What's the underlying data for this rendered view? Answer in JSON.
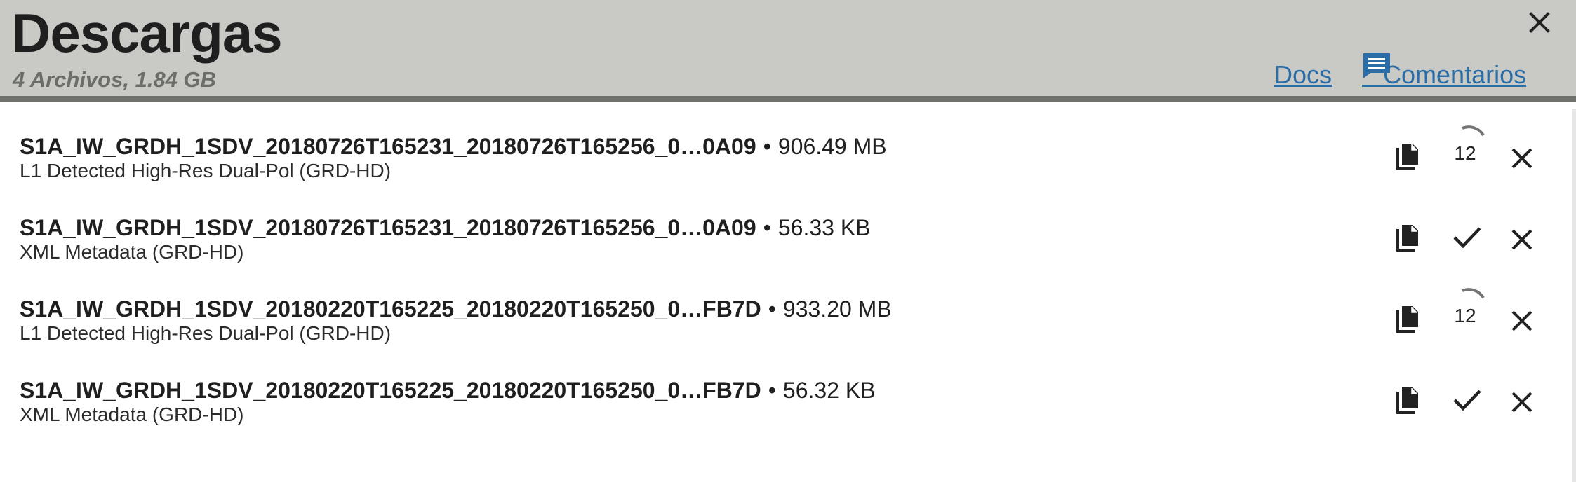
{
  "header": {
    "title": "Descargas",
    "subtitle": "4 Archivos, 1.84 GB",
    "docs_label": "Docs",
    "feedback_label": "Comentarios",
    "close_icon": "close-icon",
    "feedback_icon": "comment-icon"
  },
  "colors": {
    "header_bg": "#c9cac6",
    "header_border": "#6f716d",
    "link": "#2a6da7",
    "text": "#1f1f1f"
  },
  "downloads": [
    {
      "name": "S1A_IW_GRDH_1SDV_20180726T165231_20180726T165256_0…0A09",
      "size": "906.49 MB",
      "type": "L1 Detected High-Res Dual-Pol (GRD-HD)",
      "status": "downloading",
      "progress_text": "12"
    },
    {
      "name": "S1A_IW_GRDH_1SDV_20180726T165231_20180726T165256_0…0A09",
      "size": "56.33 KB",
      "type": "XML Metadata (GRD-HD)",
      "status": "complete",
      "progress_text": ""
    },
    {
      "name": "S1A_IW_GRDH_1SDV_20180220T165225_20180220T165250_0…FB7D",
      "size": "933.20 MB",
      "type": "L1 Detected High-Res Dual-Pol (GRD-HD)",
      "status": "downloading",
      "progress_text": "12"
    },
    {
      "name": "S1A_IW_GRDH_1SDV_20180220T165225_20180220T165250_0…FB7D",
      "size": "56.32 KB",
      "type": "XML Metadata (GRD-HD)",
      "status": "complete",
      "progress_text": ""
    }
  ]
}
